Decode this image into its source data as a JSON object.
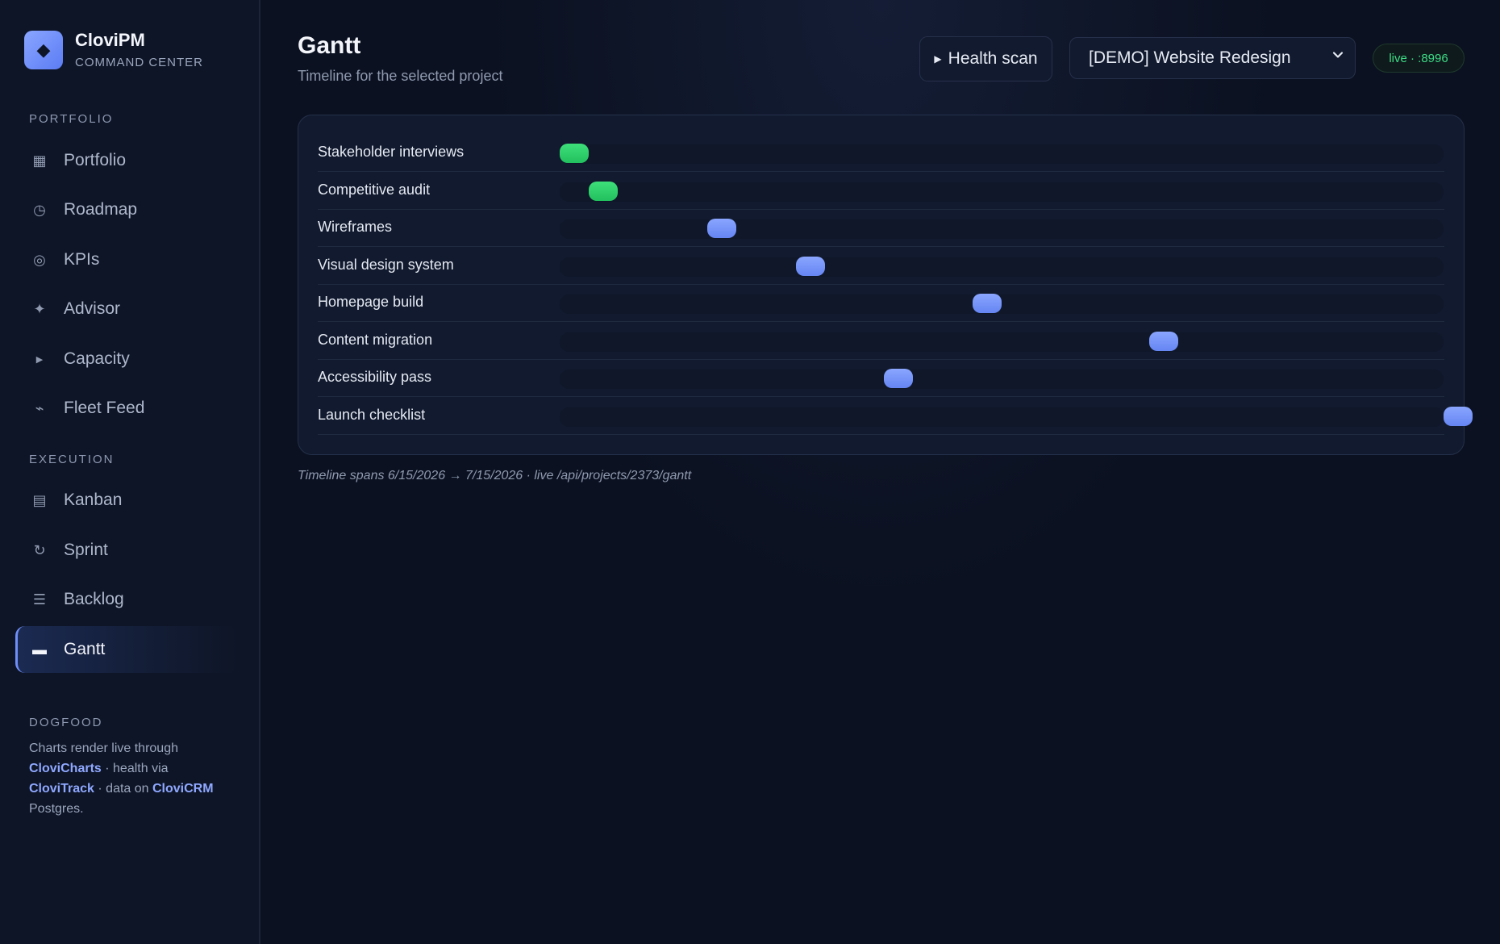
{
  "brand": {
    "name": "CloviPM",
    "subtitle": "COMMAND CENTER",
    "logo_icon": "diamond-icon"
  },
  "sidebar": {
    "sections": [
      {
        "label": "PORTFOLIO"
      },
      {
        "label": "EXECUTION"
      },
      {
        "label": "DOGFOOD"
      }
    ],
    "portfolio_items": [
      {
        "label": "Portfolio",
        "icon": "grid-icon"
      },
      {
        "label": "Roadmap",
        "icon": "clock-icon"
      },
      {
        "label": "KPIs",
        "icon": "target-icon"
      },
      {
        "label": "Advisor",
        "icon": "sparkle-icon"
      },
      {
        "label": "Capacity",
        "icon": "triangle-icon"
      },
      {
        "label": "Fleet Feed",
        "icon": "pulse-icon"
      }
    ],
    "execution_items": [
      {
        "label": "Kanban",
        "icon": "board-icon"
      },
      {
        "label": "Sprint",
        "icon": "refresh-icon"
      },
      {
        "label": "Backlog",
        "icon": "list-icon"
      },
      {
        "label": "Gantt",
        "icon": "bar-icon",
        "active": true
      }
    ],
    "dogfood": {
      "t1": "Charts render live through",
      "l1": "CloviCharts",
      "t2": "· health via",
      "l2": "CloviTrack",
      "t3": "· data on",
      "l3": "CloviCRM",
      "t4": "Postgres."
    }
  },
  "header": {
    "title": "Gantt",
    "subtitle": "Timeline for the selected project",
    "health_button": "Health scan",
    "project_select": "[DEMO] Website Redesign",
    "live_badge": "live · :8996"
  },
  "gantt": {
    "tasks": [
      {
        "name": "Stakeholder interviews",
        "position": 0.0,
        "color": "#2fd06a"
      },
      {
        "name": "Competitive audit",
        "position": 0.033,
        "color": "#2fd06a"
      },
      {
        "name": "Wireframes",
        "position": 0.167,
        "color": "#7596f8"
      },
      {
        "name": "Visual design system",
        "position": 0.267,
        "color": "#7596f8"
      },
      {
        "name": "Homepage build",
        "position": 0.467,
        "color": "#7596f8"
      },
      {
        "name": "Content migration",
        "position": 0.667,
        "color": "#7596f8"
      },
      {
        "name": "Accessibility pass",
        "position": 0.367,
        "color": "#7596f8"
      },
      {
        "name": "Launch checklist",
        "position": 1.0,
        "color": "#7596f8"
      }
    ]
  },
  "footnote": "Timeline spans 6/15/2026 → 7/15/2026 · live /api/projects/2373/gantt"
}
